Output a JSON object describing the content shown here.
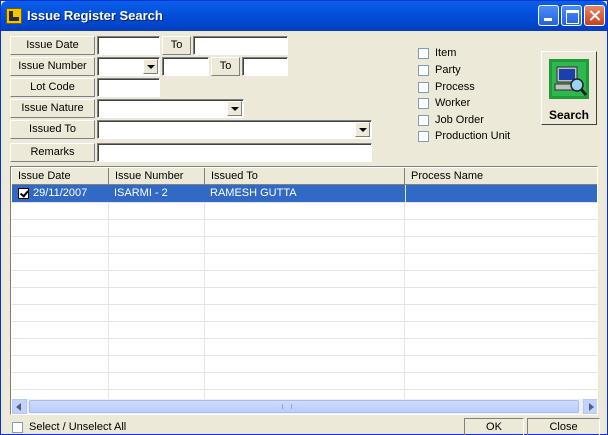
{
  "window": {
    "title": "Issue Register Search"
  },
  "filters": {
    "issue_date_label": "Issue Date",
    "issue_date_to_label": "To",
    "issue_number_label": "Issue Number",
    "issue_number_to_label": "To",
    "lot_code_label": "Lot Code",
    "issue_nature_label": "Issue Nature",
    "issued_to_label": "Issued To",
    "remarks_label": "Remarks"
  },
  "options": [
    "Item",
    "Party",
    "Process",
    "Worker",
    "Job Order",
    "Production Unit"
  ],
  "search_button": {
    "label": "Search",
    "icon": "computer-search-icon"
  },
  "grid": {
    "columns": [
      "Issue Date",
      "Issue Number",
      "Issued To",
      "Process Name"
    ],
    "rows": [
      {
        "issue_date": "29/11/2007",
        "issue_number": "ISARMI - 2",
        "issued_to": "RAMESH GUTTA",
        "process_name": "",
        "checked": true,
        "selected": true
      }
    ]
  },
  "footer": {
    "select_all_label": "Select / Unselect All",
    "ok_label": "OK",
    "close_label": "Close"
  },
  "colors": {
    "selection": "#316ac5",
    "titlebar": "#0351dd"
  }
}
